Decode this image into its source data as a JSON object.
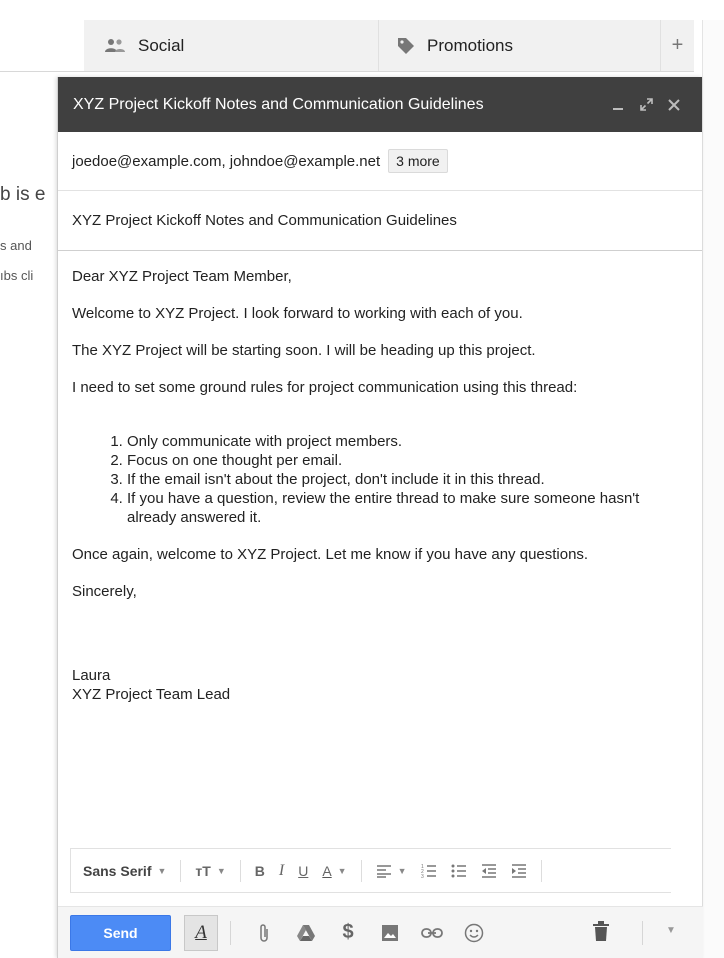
{
  "tabs": [
    {
      "label": "Social",
      "icon": "people-icon"
    },
    {
      "label": "Promotions",
      "icon": "tag-icon"
    }
  ],
  "tab_add_label": "+",
  "background_fragments": [
    "b is e",
    "s and",
    "ıbs cli"
  ],
  "compose": {
    "title": "XYZ Project Kickoff Notes and Communication Guidelines",
    "window_buttons": {
      "minimize": "_",
      "expand": "⤢",
      "close": "✕"
    },
    "recipients": "joedoe@example.com, johndoe@example.net",
    "more_recipients": "3 more",
    "subject": "XYZ Project Kickoff Notes and Communication Guidelines",
    "body": {
      "greeting": "Dear XYZ Project Team Member,",
      "p1": "Welcome to XYZ Project. I look forward to working with each of you.",
      "p2": "The XYZ Project will be starting soon. I will be heading up this project.",
      "p3": "I need to set some ground rules for project communication using this thread:",
      "rules": [
        "Only communicate with project members.",
        "Focus on one thought per email.",
        "If the email isn't about the project, don't include it in this thread.",
        "If you have a question, review the entire thread to make sure someone hasn't already answered it."
      ],
      "p4": "Once again, welcome to XYZ Project. Let me know if you have any questions.",
      "closing": "Sincerely,",
      "signature_name": "Laura",
      "signature_title": "XYZ Project Team Lead"
    },
    "format_toolbar": {
      "font": "Sans Serif",
      "size_icon": "ᴛT",
      "bold": "B",
      "italic": "I",
      "underline": "U",
      "text_color": "A"
    },
    "send_label": "Send",
    "formatting_toggle_label": "A",
    "accent_color": "#4c8bf5",
    "titlebar_color": "#404040"
  }
}
